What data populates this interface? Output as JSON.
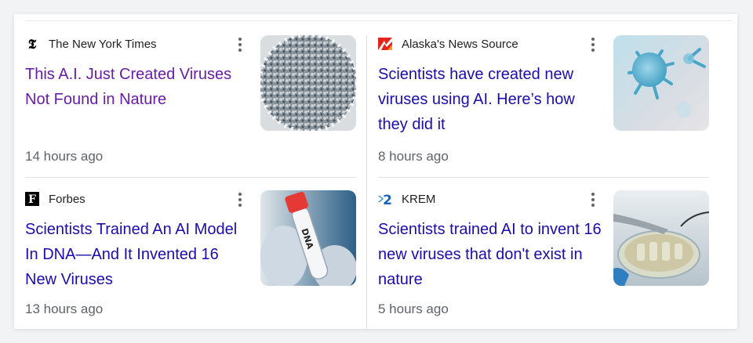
{
  "articles": [
    {
      "source": "The New York Times",
      "favicon": "nyt-logo-icon",
      "headline": "This A.I. Just Created Viruses Not Found in Nature",
      "time": "14 hours ago",
      "thumbnail": "virus-closeup-image",
      "visited": true
    },
    {
      "source": "Alaska's News Source",
      "favicon": "alaskas-news-source-logo-icon",
      "headline": "Scientists have created new viruses using AI. Here’s how they did it",
      "time": "8 hours ago",
      "thumbnail": "blue-virus-image",
      "visited": false
    },
    {
      "source": "Forbes",
      "favicon": "forbes-logo-icon",
      "headline": "Scientists Trained An AI Model In DNA—And It Invented 16 New Viruses",
      "time": "13 hours ago",
      "thumbnail": "dna-tube-image",
      "thumbnail_text": "DNA",
      "visited": false
    },
    {
      "source": "KREM",
      "favicon": "krem-logo-icon",
      "headline": "Scientists trained AI to invent 16 new viruses that don't exist in nature",
      "time": "5 hours ago",
      "thumbnail": "petri-dish-image",
      "visited": false
    }
  ],
  "colors": {
    "link": "#1a0dab",
    "visited_link": "#681da8",
    "meta_text": "#5f6368"
  }
}
